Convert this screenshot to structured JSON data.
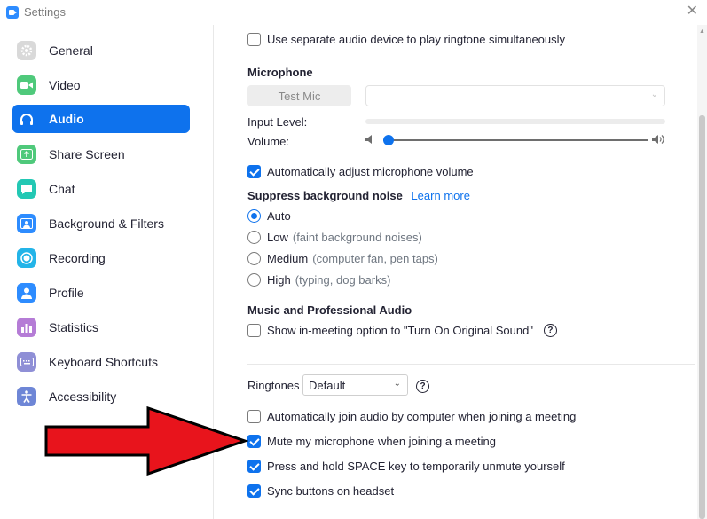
{
  "window": {
    "title": "Settings"
  },
  "sidebar": {
    "items": [
      {
        "label": "General",
        "icon": "gear-icon",
        "color": "#c4c4c4",
        "active": false
      },
      {
        "label": "Video",
        "icon": "video-camera-icon",
        "color": "#4fc97b",
        "active": false
      },
      {
        "label": "Audio",
        "icon": "headphones-icon",
        "color": "#ffffff",
        "active": true
      },
      {
        "label": "Share Screen",
        "icon": "share-screen-icon",
        "color": "#4fc97b",
        "active": false
      },
      {
        "label": "Chat",
        "icon": "chat-icon",
        "color": "#23c8b4",
        "active": false
      },
      {
        "label": "Background & Filters",
        "icon": "background-icon",
        "color": "#2d8cff",
        "active": false
      },
      {
        "label": "Recording",
        "icon": "recording-icon",
        "color": "#23c8b4",
        "active": false
      },
      {
        "label": "Profile",
        "icon": "profile-icon",
        "color": "#2d8cff",
        "active": false
      },
      {
        "label": "Statistics",
        "icon": "statistics-icon",
        "color": "#b57cd6",
        "active": false
      },
      {
        "label": "Keyboard Shortcuts",
        "icon": "keyboard-icon",
        "color": "#8f8fd6",
        "active": false
      },
      {
        "label": "Accessibility",
        "icon": "accessibility-icon",
        "color": "#6e86d6",
        "active": false
      }
    ]
  },
  "audio": {
    "separate_device_label": "Use separate audio device to play ringtone simultaneously",
    "separate_device_checked": false,
    "microphone_heading": "Microphone",
    "test_mic_label": "Test Mic",
    "mic_select_value": "",
    "input_level_label": "Input Level:",
    "volume_label": "Volume:",
    "volume_level": 0.02,
    "auto_adjust_label": "Automatically adjust microphone volume",
    "auto_adjust_checked": true,
    "suppress_heading": "Suppress background noise",
    "learn_more_label": "Learn more",
    "noise_options": [
      {
        "label": "Auto",
        "hint": "",
        "selected": true
      },
      {
        "label": "Low",
        "hint": "(faint background noises)",
        "selected": false
      },
      {
        "label": "Medium",
        "hint": "(computer fan, pen taps)",
        "selected": false
      },
      {
        "label": "High",
        "hint": "(typing, dog barks)",
        "selected": false
      }
    ],
    "music_heading": "Music and Professional Audio",
    "original_sound_label": "Show in-meeting option to \"Turn On Original Sound\"",
    "original_sound_checked": false,
    "ringtones_label": "Ringtones",
    "ringtone_value": "Default",
    "auto_join_label": "Automatically join audio by computer when joining a meeting",
    "auto_join_checked": false,
    "mute_label": "Mute my microphone when joining a meeting",
    "mute_checked": true,
    "space_label": "Press and hold SPACE key to temporarily unmute yourself",
    "space_checked": true,
    "sync_label": "Sync buttons on headset",
    "sync_checked": true
  },
  "annotation": {
    "arrow_color": "#e8141c"
  }
}
